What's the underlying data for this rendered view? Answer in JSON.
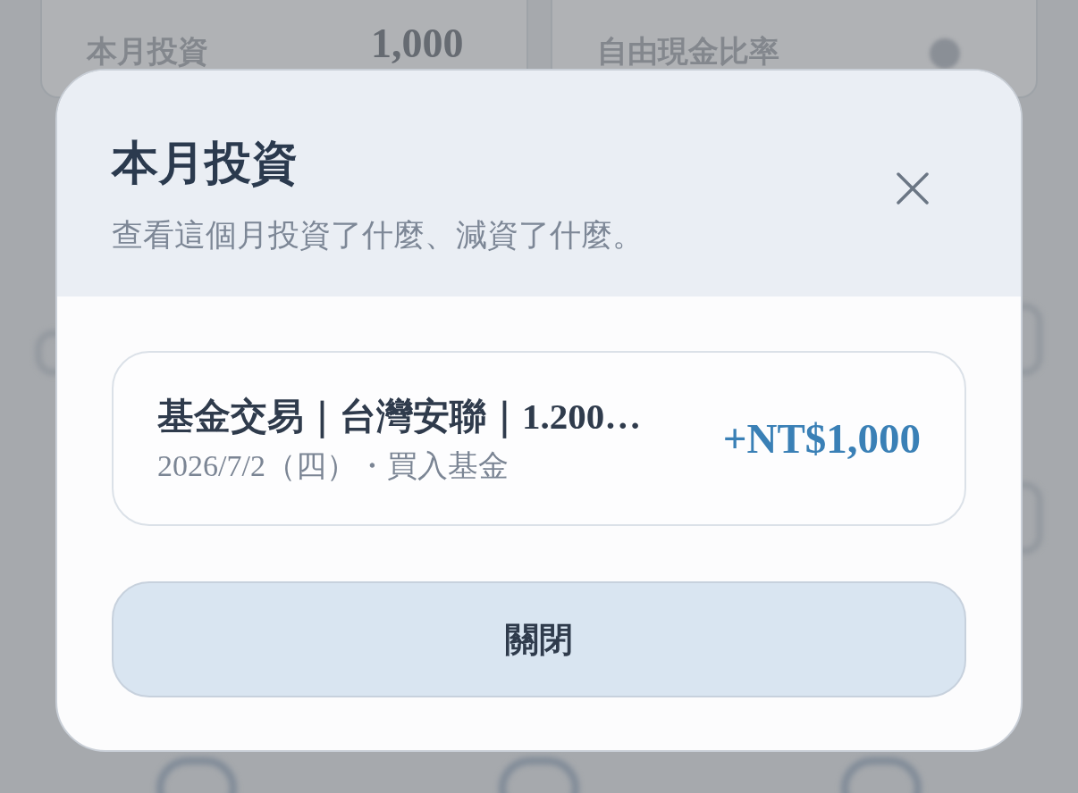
{
  "background": {
    "cards": [
      {
        "label": "本月投資",
        "value": "1,000"
      },
      {
        "label": "自由現金比率"
      }
    ]
  },
  "dialog": {
    "title": "本月投資",
    "subtitle": "查看這個月投資了什麼、減資了什麼。",
    "items": [
      {
        "title": "基金交易｜台灣安聯｜1.200…",
        "detail": "2026/7/2（四）・買入基金",
        "amount": "+NT$1,000"
      }
    ],
    "buttons": [
      "關閉"
    ]
  }
}
